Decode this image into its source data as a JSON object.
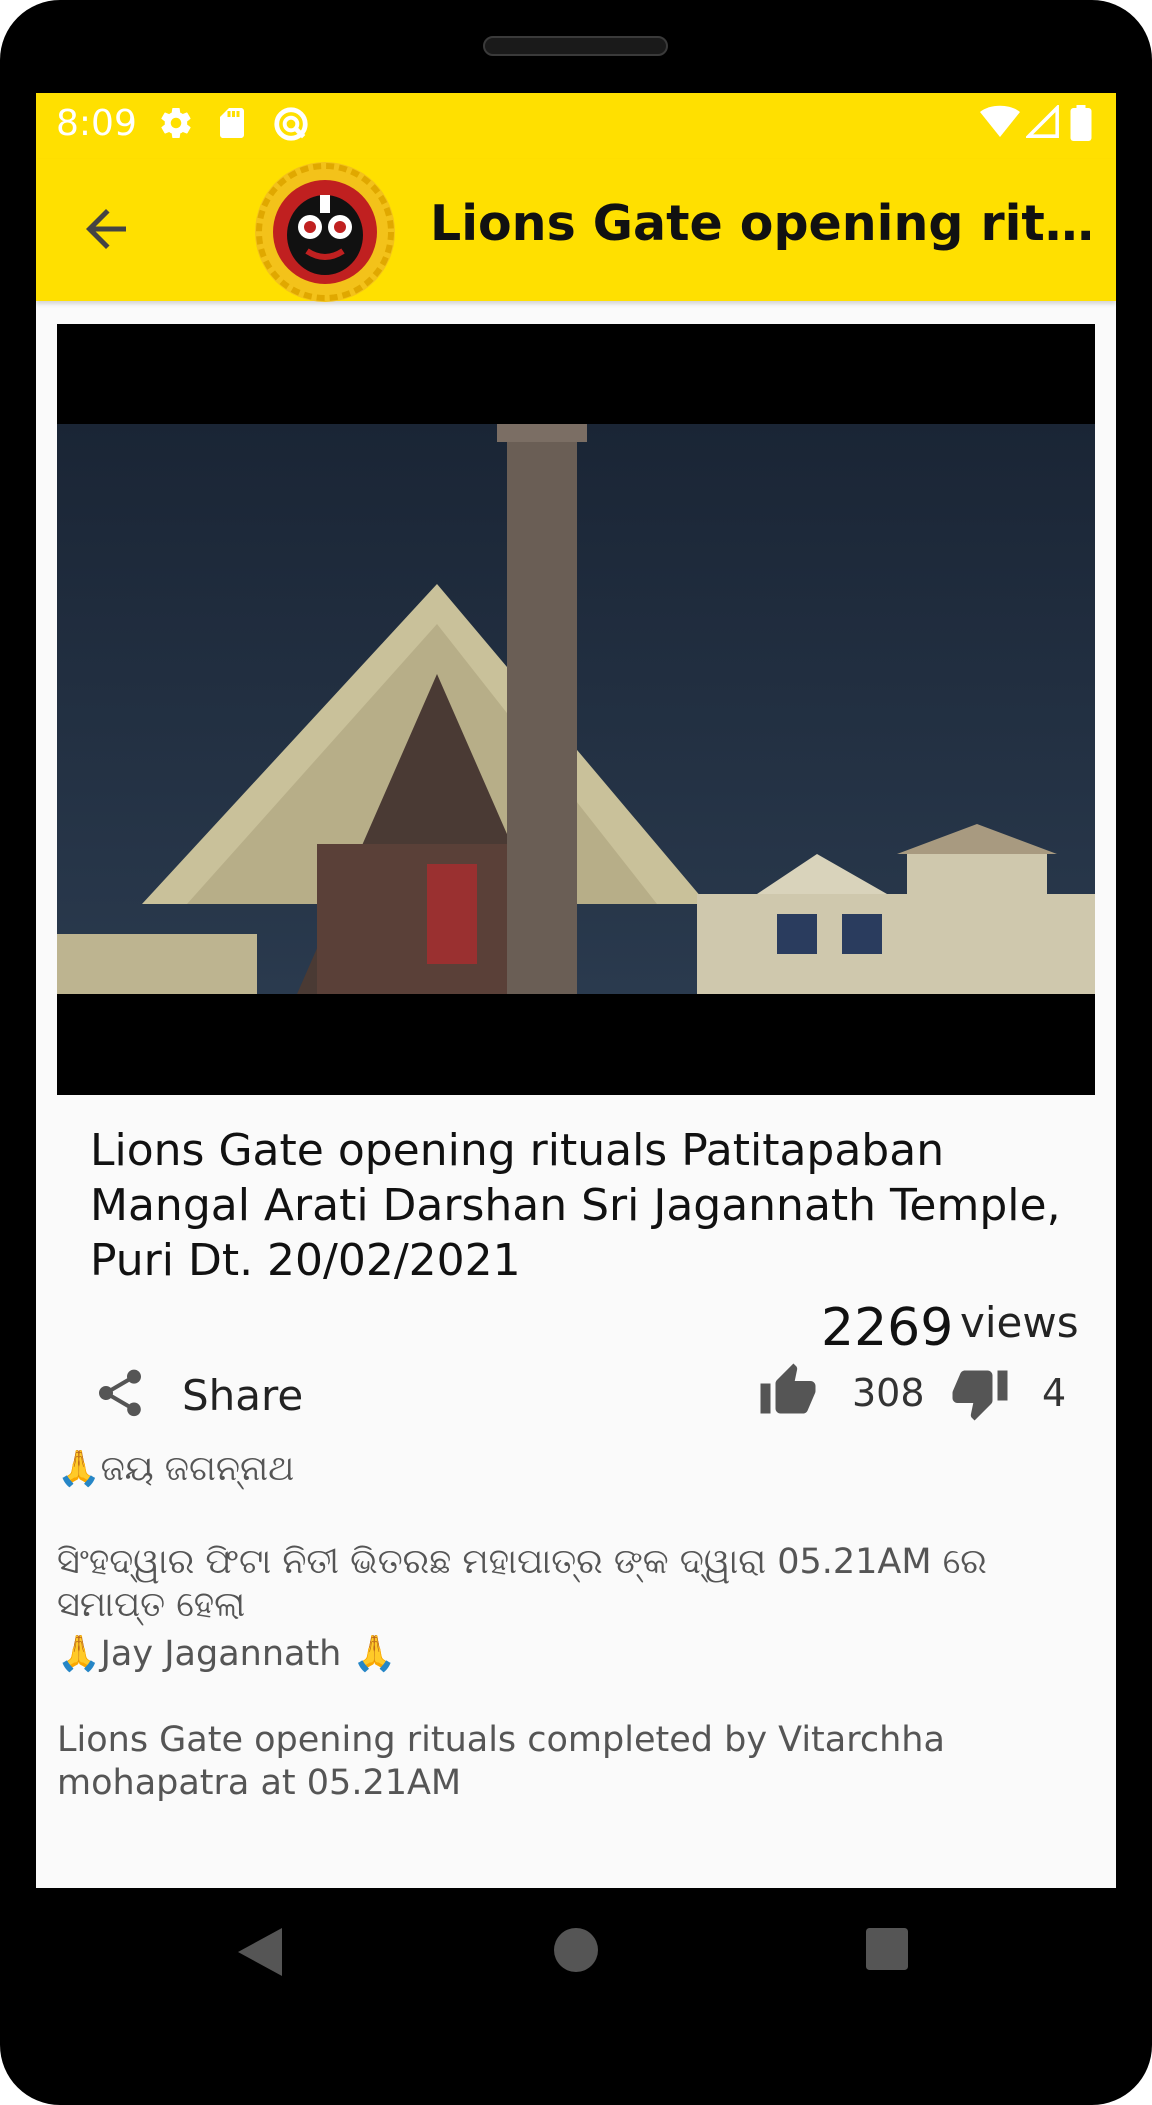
{
  "status_bar": {
    "time": "8:09",
    "left_icons": [
      "gear-icon",
      "sd-card-icon",
      "sync-icon"
    ],
    "right_icons": [
      "wifi-icon",
      "signal-icon",
      "battery-icon"
    ]
  },
  "app_bar": {
    "title": "Lions Gate opening rituals...",
    "back_icon": "arrow-left-icon",
    "logo": "jagannath-logo"
  },
  "video": {
    "title": "Lions Gate opening rituals Patitapaban Mangal Arati Darshan Sri Jagannath Temple, Puri Dt. 20/02/2021"
  },
  "stats": {
    "views_count": "2269",
    "views_label": "views",
    "likes": "308",
    "dislikes": "4"
  },
  "share": {
    "label": "Share"
  },
  "description": {
    "odia_greeting": "ଜୟ ଜଗନ୍ନାଥ",
    "odia_text": "ସିଂହଦ୍ୱାର ଫିଟା ନିତୀ ଭିତରଛ ମହାପାତ୍ର ଙ୍କ ଦ୍ୱାରା 05.21AM ରେ ସମାପ୍ତ ହେଲା",
    "english_greeting": "Jay Jagannath",
    "english_text": "Lions Gate opening rituals completed by Vitarchha mohapatra at 05.21AM"
  },
  "colors": {
    "accent": "#ffe000",
    "background": "#fafafa"
  },
  "nav": {
    "back_icon": "triangle-back-icon",
    "home_icon": "circle-home-icon",
    "recents_icon": "square-recents-icon"
  }
}
